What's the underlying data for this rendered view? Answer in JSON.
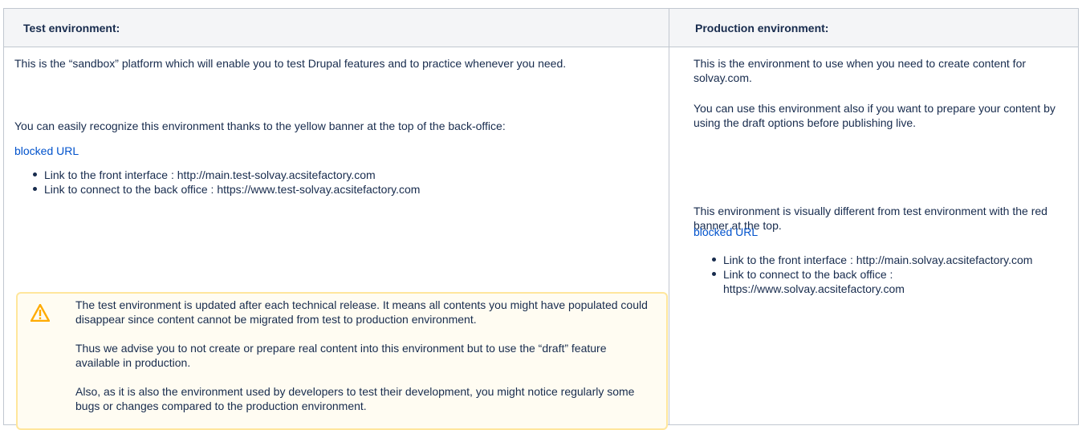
{
  "headers": {
    "test": "Test environment:",
    "production": "Production environment:"
  },
  "test": {
    "intro": "This is the “sandbox” platform which will enable you to test Drupal features and to practice whenever you need.",
    "recognize": "You can easily recognize this environment thanks to the yellow banner at the top of the back-office:",
    "blocked_url": "blocked URL",
    "links": [
      "Link to the front interface : http://main.test-solvay.acsitefactory.com",
      "Link to connect to the back office : https://www.test-solvay.acsitefactory.com"
    ],
    "warning": {
      "icon": "warning-icon",
      "paragraphs": [
        "The test environment is updated after each technical release. It means all contents you might have populated could disappear since content cannot be migrated from test to production environment.",
        "Thus we advise you to not create or prepare real content into this environment but to use the “draft” feature available in production.",
        "Also, as it is also the environment used by developers to test their development, you might notice regularly some bugs or changes compared to the production environment."
      ]
    }
  },
  "production": {
    "intro": "This is the environment to use when you need to create content for solvay.com.",
    "draft": "You can use this environment also if you want to prepare your content by using the draft options before publishing live.",
    "visual": "This environment is visually different from test environment with the red banner at the top.",
    "blocked_url": "blocked URL",
    "links": [
      "Link to the front interface : http://main.solvay.acsitefactory.com",
      "Link to connect to the back office : https://www.solvay.acsitefactory.com"
    ]
  },
  "colors": {
    "link": "#0052cc",
    "header_bg": "#f4f5f7",
    "warning_bg": "#fffcf2",
    "warning_border": "#ffe69c",
    "warning_icon": "#ffab00"
  }
}
